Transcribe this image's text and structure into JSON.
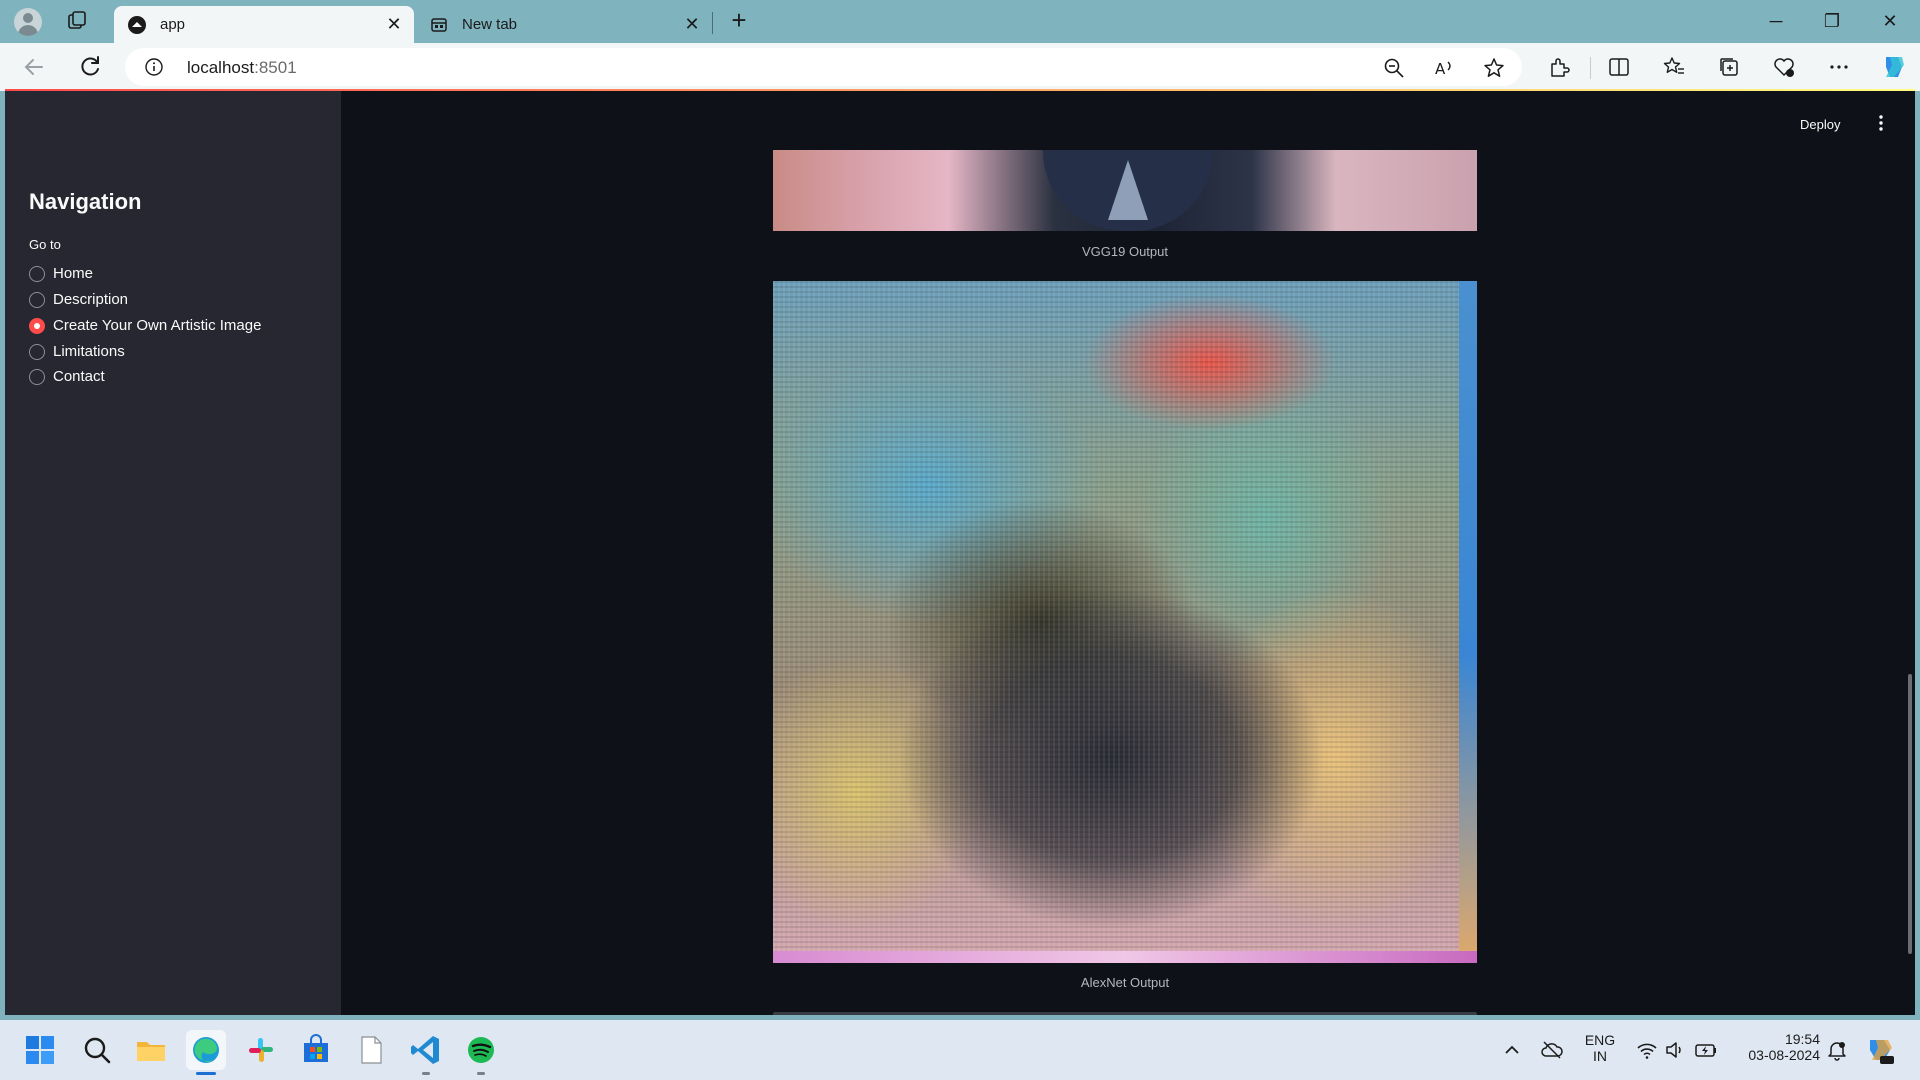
{
  "browser": {
    "tabs": [
      {
        "title": "app",
        "active": true
      },
      {
        "title": "New tab",
        "active": false
      }
    ],
    "address": {
      "host": "localhost",
      "port": ":8501"
    }
  },
  "app": {
    "header": {
      "deploy_label": "Deploy"
    },
    "sidebar": {
      "title": "Navigation",
      "radio_label": "Go to",
      "options": [
        "Home",
        "Description",
        "Create Your Own Artistic Image",
        "Limitations",
        "Contact"
      ],
      "selected": "Create Your Own Artistic Image"
    },
    "main": {
      "captions": {
        "vgg19": "VGG19 Output",
        "alexnet": "AlexNet Output"
      }
    }
  },
  "taskbar": {
    "language": {
      "line1": "ENG",
      "line2": "IN"
    },
    "clock": {
      "time": "19:54",
      "date": "03-08-2024"
    }
  },
  "colors": {
    "accent": "#ff4b4b",
    "app_bg": "#0e1117",
    "sidebar_bg": "#262730"
  }
}
